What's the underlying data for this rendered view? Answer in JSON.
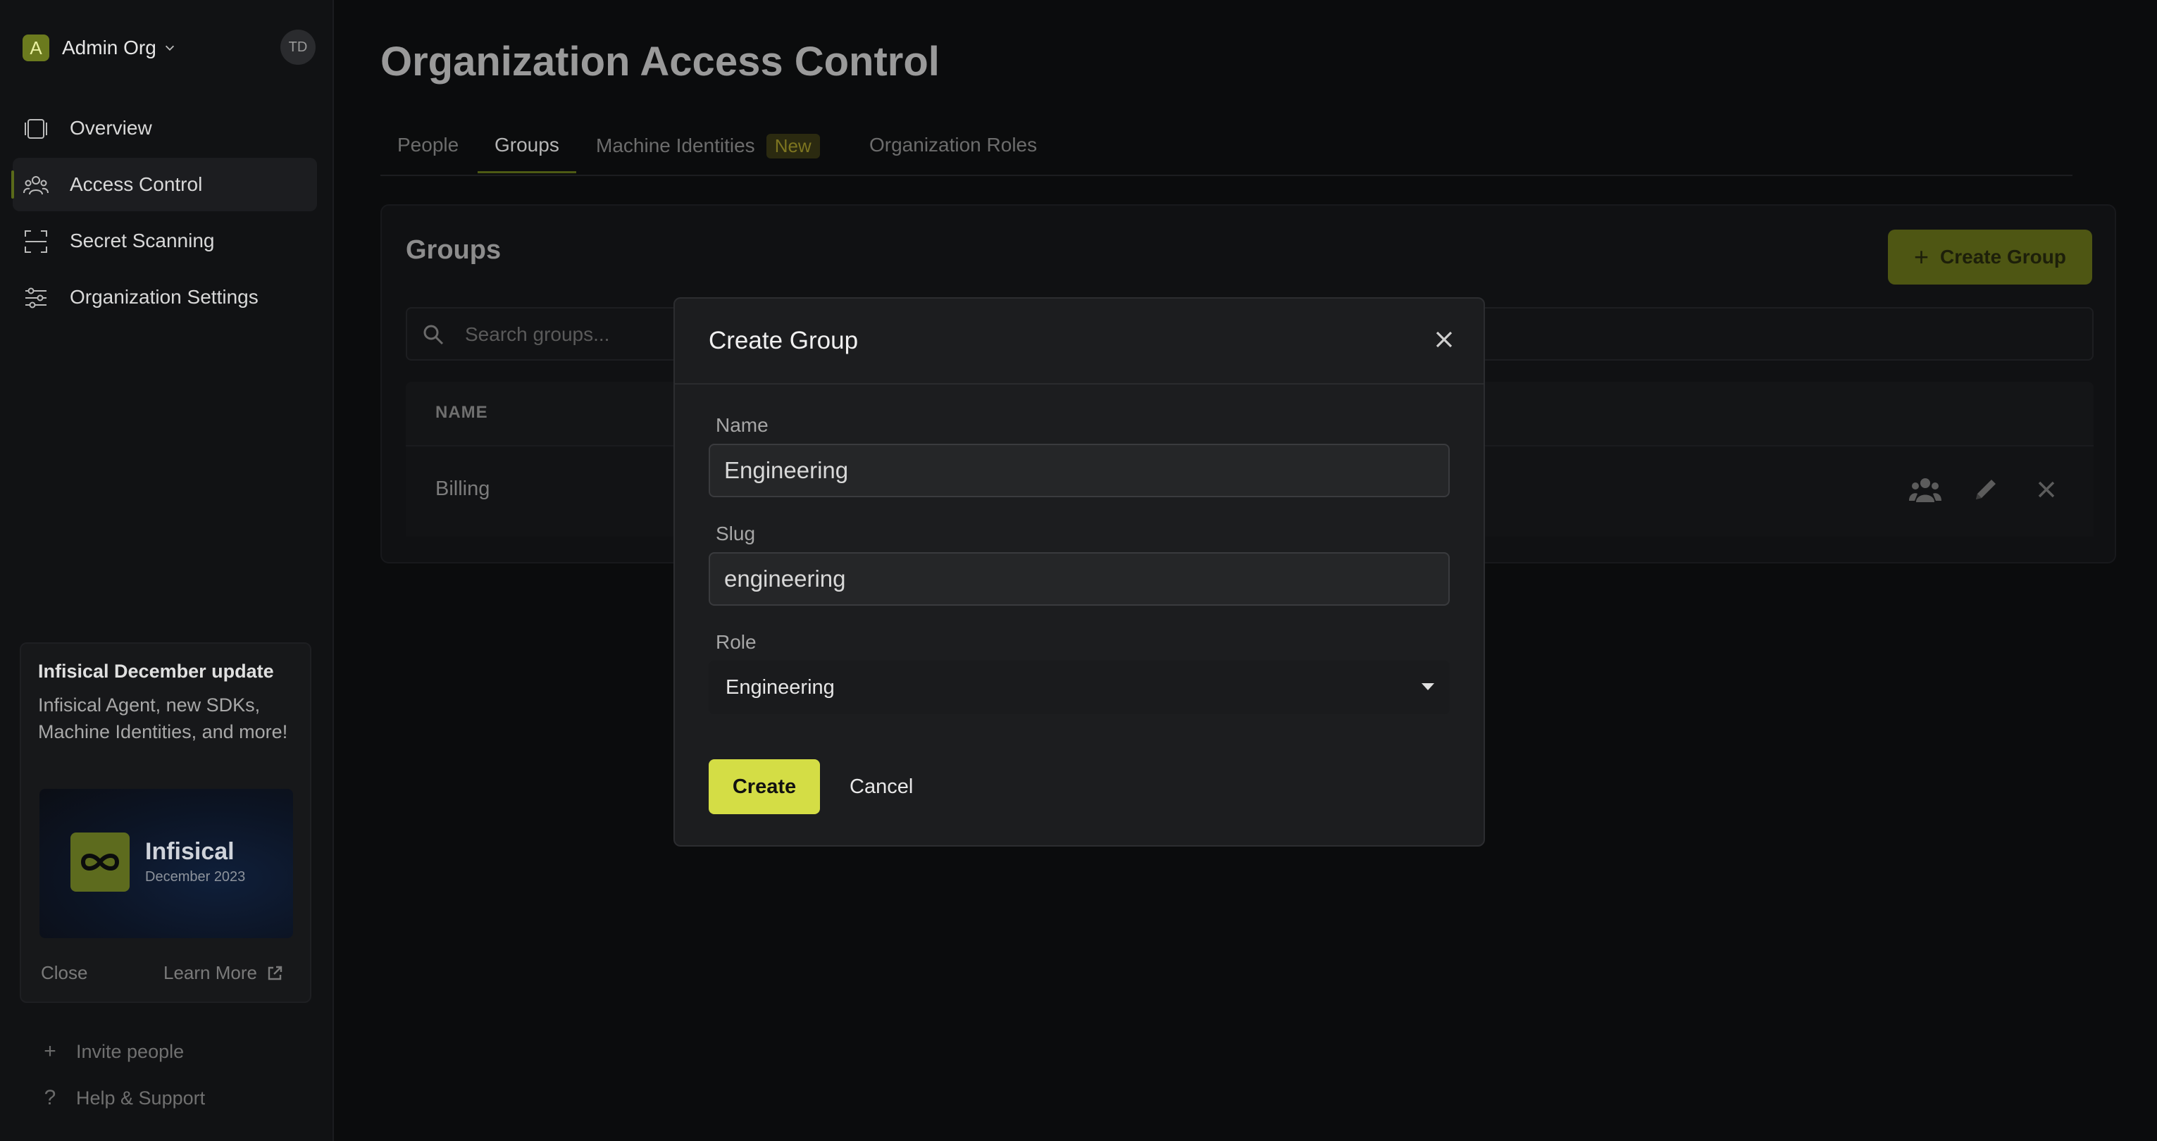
{
  "org": {
    "badge": "A",
    "name": "Admin Org",
    "avatar": "TD"
  },
  "sidebar": {
    "items": [
      {
        "label": "Overview",
        "icon": "overview-icon"
      },
      {
        "label": "Access Control",
        "icon": "users-icon",
        "active": true
      },
      {
        "label": "Secret Scanning",
        "icon": "scan-icon"
      },
      {
        "label": "Organization Settings",
        "icon": "settings-sliders-icon"
      }
    ],
    "update": {
      "title": "Infisical December update",
      "body": "Infisical Agent, new SDKs, Machine Identities, and more!",
      "brand": "Infisical",
      "date": "December 2023",
      "close": "Close",
      "learn_more": "Learn More"
    },
    "footer": {
      "invite": "Invite people",
      "help": "Help & Support"
    }
  },
  "main": {
    "title": "Organization Access Control",
    "tabs": [
      {
        "label": "People"
      },
      {
        "label": "Groups",
        "active": true
      },
      {
        "label": "Machine Identities",
        "badge": "New"
      },
      {
        "label": "Organization Roles"
      }
    ],
    "panel": {
      "title": "Groups",
      "create_button": "Create Group",
      "search_placeholder": "Search groups...",
      "columns": {
        "name": "NAME"
      },
      "rows": [
        {
          "name": "Billing"
        }
      ]
    }
  },
  "modal": {
    "title": "Create Group",
    "name_label": "Name",
    "name_value": "Engineering",
    "slug_label": "Slug",
    "slug_value": "engineering",
    "role_label": "Role",
    "role_value": "Engineering",
    "create_label": "Create",
    "cancel_label": "Cancel"
  },
  "colors": {
    "accent": "#d4dd45",
    "background": "#0b0c0d",
    "modal": "#1c1d1f"
  }
}
